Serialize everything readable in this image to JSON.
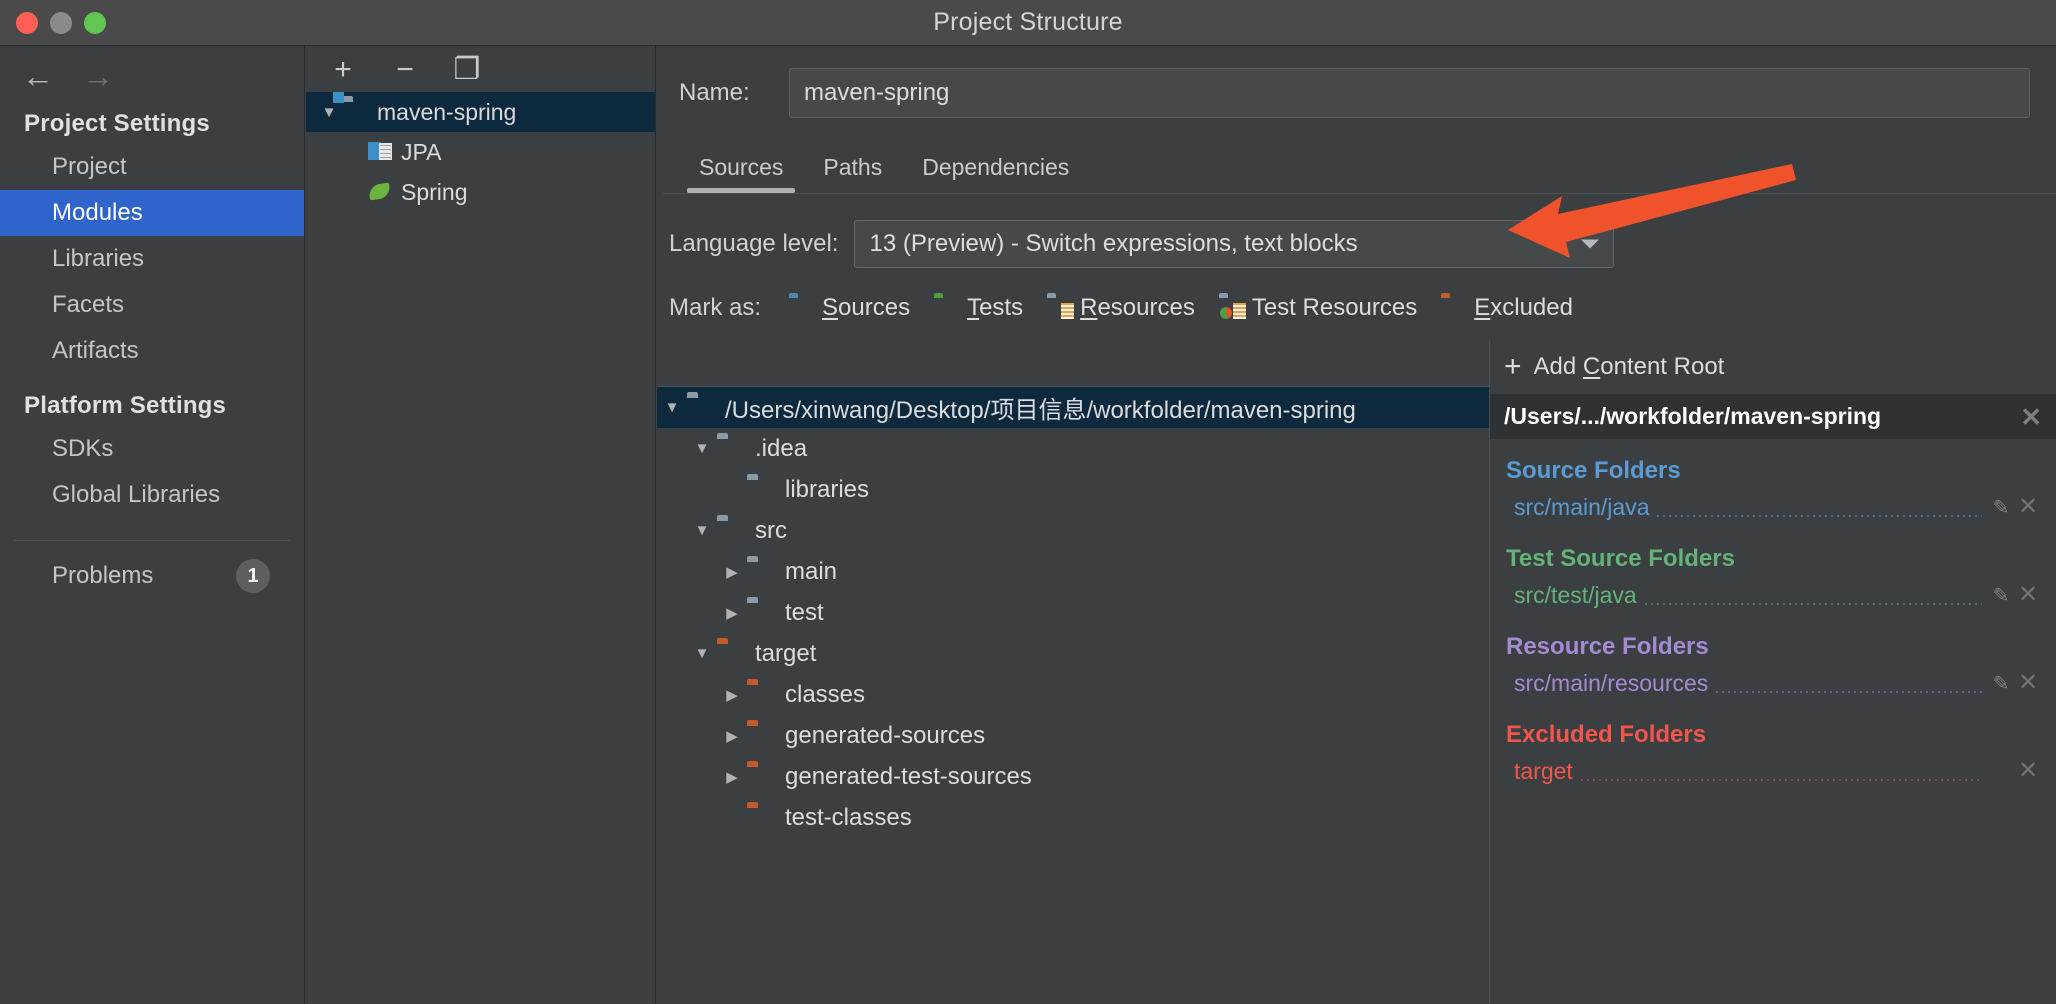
{
  "window": {
    "title": "Project Structure",
    "traffic_lights": [
      "close-red",
      "minimize-gray",
      "zoom-green"
    ]
  },
  "nav": {
    "back_icon": "←",
    "forward_icon": "→"
  },
  "sidebar": {
    "sections": [
      {
        "heading": "Project Settings",
        "items": [
          {
            "label": "Project",
            "selected": false
          },
          {
            "label": "Modules",
            "selected": true
          },
          {
            "label": "Libraries",
            "selected": false
          },
          {
            "label": "Facets",
            "selected": false
          },
          {
            "label": "Artifacts",
            "selected": false
          }
        ]
      },
      {
        "heading": "Platform Settings",
        "items": [
          {
            "label": "SDKs",
            "selected": false
          },
          {
            "label": "Global Libraries",
            "selected": false
          }
        ]
      }
    ],
    "problems": {
      "label": "Problems",
      "count": "1"
    }
  },
  "modules_pane": {
    "toolbar": [
      {
        "name": "add-module-button",
        "glyph": "+"
      },
      {
        "name": "remove-module-button",
        "glyph": "−"
      },
      {
        "name": "copy-module-button",
        "glyph": "❐"
      }
    ],
    "tree": [
      {
        "label": "maven-spring",
        "icon": "module-folder-icon",
        "twisty": "▼",
        "selected": true,
        "depth": 0
      },
      {
        "label": "JPA",
        "icon": "jpa-facet-icon",
        "twisty": "",
        "selected": false,
        "depth": 1
      },
      {
        "label": "Spring",
        "icon": "spring-leaf-icon",
        "twisty": "",
        "selected": false,
        "depth": 1
      }
    ]
  },
  "main": {
    "name_label": "Name:",
    "name_value": "maven-spring",
    "name_placeholder": "Module name",
    "tabs": [
      {
        "label": "Sources",
        "active": true
      },
      {
        "label": "Paths",
        "active": false
      },
      {
        "label": "Dependencies",
        "active": false
      }
    ],
    "language_level": {
      "label": "Language level:",
      "value": "13 (Preview) - Switch expressions, text blocks"
    },
    "mark_as": {
      "label": "Mark as:",
      "options": [
        {
          "label": "Sources",
          "mnemonic": "S",
          "icon": "sources-folder-icon",
          "color": "#4f88a8"
        },
        {
          "label": "Tests",
          "mnemonic": "T",
          "icon": "tests-folder-icon",
          "color": "#4e9c3f"
        },
        {
          "label": "Resources",
          "mnemonic": "R",
          "icon": "resources-folder-icon",
          "color": "#8b9aa5"
        },
        {
          "label": "Test Resources",
          "mnemonic": "",
          "icon": "test-resources-folder-icon",
          "color": "#8b9aa5"
        },
        {
          "label": "Excluded",
          "mnemonic": "E",
          "icon": "excluded-folder-icon",
          "color": "#c75a2a"
        }
      ]
    },
    "file_tree": [
      {
        "label": "/Users/xinwang/Desktop/项目信息/workfolder/maven-spring",
        "twisty": "▼",
        "depth": 0,
        "color": "#8b9aa5",
        "selected": true
      },
      {
        "label": ".idea",
        "twisty": "▼",
        "depth": 1,
        "color": "#8b9aa5",
        "selected": false
      },
      {
        "label": "libraries",
        "twisty": "",
        "depth": 2,
        "color": "#8b9aa5",
        "selected": false
      },
      {
        "label": "src",
        "twisty": "▼",
        "depth": 1,
        "color": "#8b9aa5",
        "selected": false
      },
      {
        "label": "main",
        "twisty": "▶",
        "depth": 2,
        "color": "#8b9aa5",
        "selected": false
      },
      {
        "label": "test",
        "twisty": "▶",
        "depth": 2,
        "color": "#8b9aa5",
        "selected": false
      },
      {
        "label": "target",
        "twisty": "▼",
        "depth": 1,
        "color": "#c75a2a",
        "selected": false
      },
      {
        "label": "classes",
        "twisty": "▶",
        "depth": 2,
        "color": "#c75a2a",
        "selected": false
      },
      {
        "label": "generated-sources",
        "twisty": "▶",
        "depth": 2,
        "color": "#c75a2a",
        "selected": false
      },
      {
        "label": "generated-test-sources",
        "twisty": "▶",
        "depth": 2,
        "color": "#c75a2a",
        "selected": false
      },
      {
        "label": "test-classes",
        "twisty": "",
        "depth": 2,
        "color": "#c75a2a",
        "selected": false
      }
    ]
  },
  "right_panel": {
    "add_content_root": "Add Content Root",
    "add_content_root_mnemonic": "C",
    "content_root_path": "/Users/.../workfolder/maven-spring",
    "groups": [
      {
        "title": "Source Folders",
        "color": "#5b9bd5",
        "entries": [
          {
            "path": "src/main/java",
            "has_edit": true,
            "has_remove": true
          }
        ]
      },
      {
        "title": "Test Source Folders",
        "color": "#63b27a",
        "entries": [
          {
            "path": "src/test/java",
            "has_edit": true,
            "has_remove": true
          }
        ]
      },
      {
        "title": "Resource Folders",
        "color": "#a38bd4",
        "entries": [
          {
            "path": "src/main/resources",
            "has_edit": true,
            "has_remove": true
          }
        ]
      },
      {
        "title": "Excluded Folders",
        "color": "#f4554a",
        "entries": [
          {
            "path": "target",
            "has_edit": false,
            "has_remove": true
          }
        ]
      }
    ]
  },
  "annotation": {
    "type": "arrow",
    "color": "#f0532b",
    "points_to": "language-level-combo"
  }
}
